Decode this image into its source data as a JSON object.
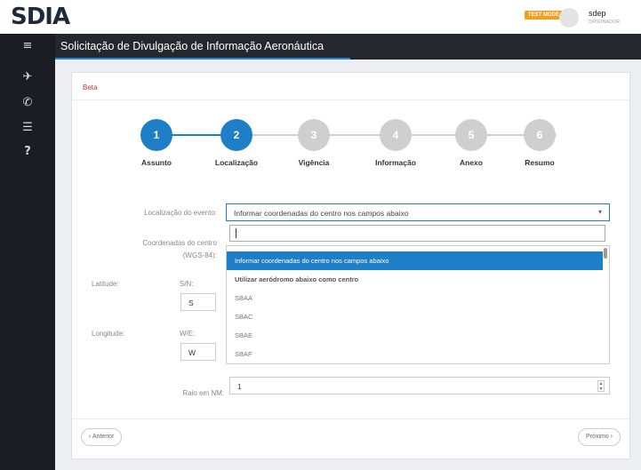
{
  "header": {
    "logo": "SDIA",
    "test_badge": "TEST MODE",
    "username": "sdep",
    "user_role": "ORIGINADOR"
  },
  "sidebar": {
    "icons": [
      "menu-icon",
      "airplane-icon",
      "phone-icon",
      "list-icon",
      "help-icon"
    ]
  },
  "page": {
    "title": "Solicitação de Divulgação de Informação Aeronáutica",
    "beta": "Beta"
  },
  "steps": [
    {
      "number": "1",
      "label": "Assunto",
      "state": "done"
    },
    {
      "number": "2",
      "label": "Localização",
      "state": "active"
    },
    {
      "number": "3",
      "label": "Vigência",
      "state": "pending"
    },
    {
      "number": "4",
      "label": "Informação",
      "state": "pending"
    },
    {
      "number": "5",
      "label": "Anexo",
      "state": "pending"
    },
    {
      "number": "6",
      "label": "Resumo",
      "state": "pending"
    }
  ],
  "form": {
    "localizacao_label": "Localização do evento:",
    "localizacao_value": "Informar coordenadas do centro nos campos abaixo",
    "coordenadas_label": "Coordenadas do centro",
    "coordenadas_sub": "(WGS-84):",
    "latitude_label": "Latitude:",
    "sn_label": "S/N:",
    "sn_value": "S",
    "longitude_label": "Longitude:",
    "we_label": "W/E:",
    "we_value": "W",
    "raio_label": "Raio em NM:",
    "raio_value": "1"
  },
  "dropdown": {
    "options": [
      "Informar coordenadas do centro nos campos abaixo",
      "Utilizar aeródromo abaixo como centro",
      "SBAA",
      "SBAC",
      "SBAE",
      "SBAF"
    ],
    "selected_index": 0
  },
  "nav": {
    "prev": "‹ Anterior",
    "next": "Próximo ›"
  },
  "colors": {
    "accent": "#1e7fc8",
    "titlebar": "#24272d",
    "sidebar": "#1b1d22",
    "badge": "#f0a020"
  }
}
